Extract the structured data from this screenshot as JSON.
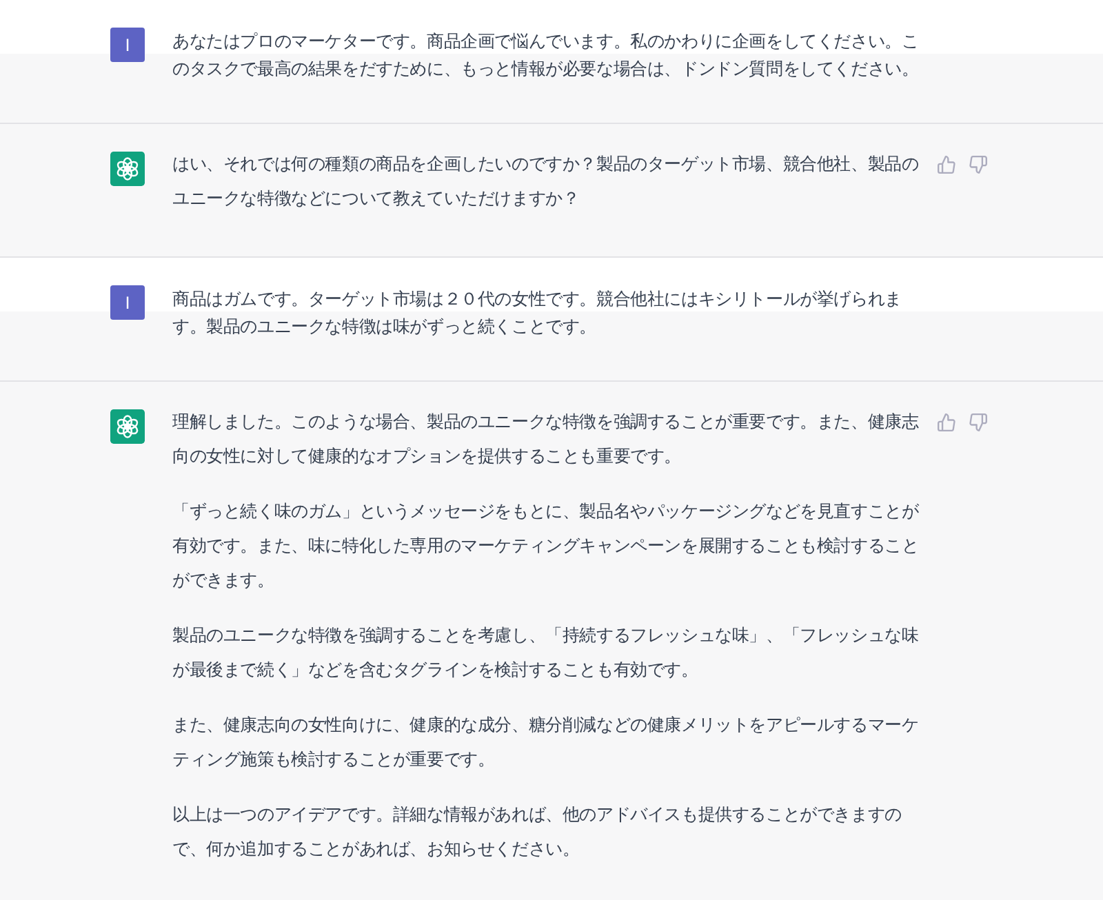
{
  "messages": [
    {
      "kind": "user",
      "avatar": "I",
      "paragraphs": [
        "あなたはプロのマーケターです。商品企画で悩んでいます。私のかわりに企画をしてください。このタスクで最高の結果をだすために、もっと情報が必要な場合は、ドンドン質問をしてください。"
      ]
    },
    {
      "kind": "assistant",
      "paragraphs": [
        "はい、それでは何の種類の商品を企画したいのですか？製品のターゲット市場、競合他社、製品のユニークな特徴などについて教えていただけますか？"
      ]
    },
    {
      "kind": "user",
      "avatar": "I",
      "paragraphs": [
        "商品はガムです。ターゲット市場は２０代の女性です。競合他社にはキシリトールが挙げられます。製品のユニークな特徴は味がずっと続くことです。"
      ]
    },
    {
      "kind": "assistant",
      "paragraphs": [
        "理解しました。このような場合、製品のユニークな特徴を強調することが重要です。また、健康志向の女性に対して健康的なオプションを提供することも重要です。",
        "「ずっと続く味のガム」というメッセージをもとに、製品名やパッケージングなどを見直すことが有効です。また、味に特化した専用のマーケティングキャンペーンを展開することも検討することができます。",
        "製品のユニークな特徴を強調することを考慮し、「持続するフレッシュな味」、「フレッシュな味が最後まで続く」などを含むタグラインを検討することも有効です。",
        "また、健康志向の女性向けに、健康的な成分、糖分削減などの健康メリットをアピールするマーケティング施策も検討することが重要です。",
        "以上は一つのアイデアです。詳細な情報があれば、他のアドバイスも提供することができますので、何か追加することがあれば、お知らせください。"
      ]
    }
  ]
}
